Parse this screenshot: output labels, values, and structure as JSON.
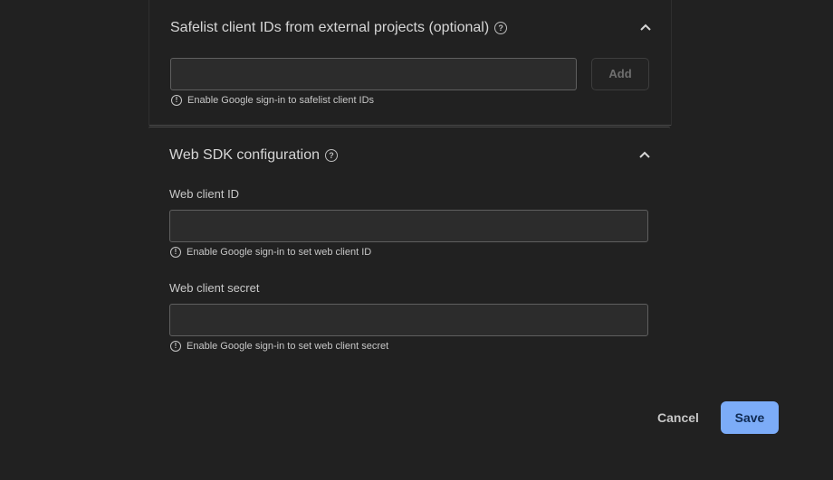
{
  "safelist": {
    "title": "Safelist client IDs from external projects (optional)",
    "input_value": "",
    "add_label": "Add",
    "hint": "Enable Google sign-in to safelist client IDs"
  },
  "web_sdk": {
    "title": "Web SDK configuration",
    "client_id_label": "Web client ID",
    "client_id_value": "",
    "client_id_hint": "Enable Google sign-in to set web client ID",
    "client_secret_label": "Web client secret",
    "client_secret_value": "",
    "client_secret_hint": "Enable Google sign-in to set web client secret"
  },
  "actions": {
    "cancel_label": "Cancel",
    "save_label": "Save"
  },
  "icons": {
    "help": "help-circle-icon",
    "info": "info-circle-icon",
    "chevron": "chevron-up-icon"
  },
  "colors": {
    "background": "#212121",
    "primary_button": "#7cacf8",
    "primary_button_text": "#0f2a52"
  }
}
